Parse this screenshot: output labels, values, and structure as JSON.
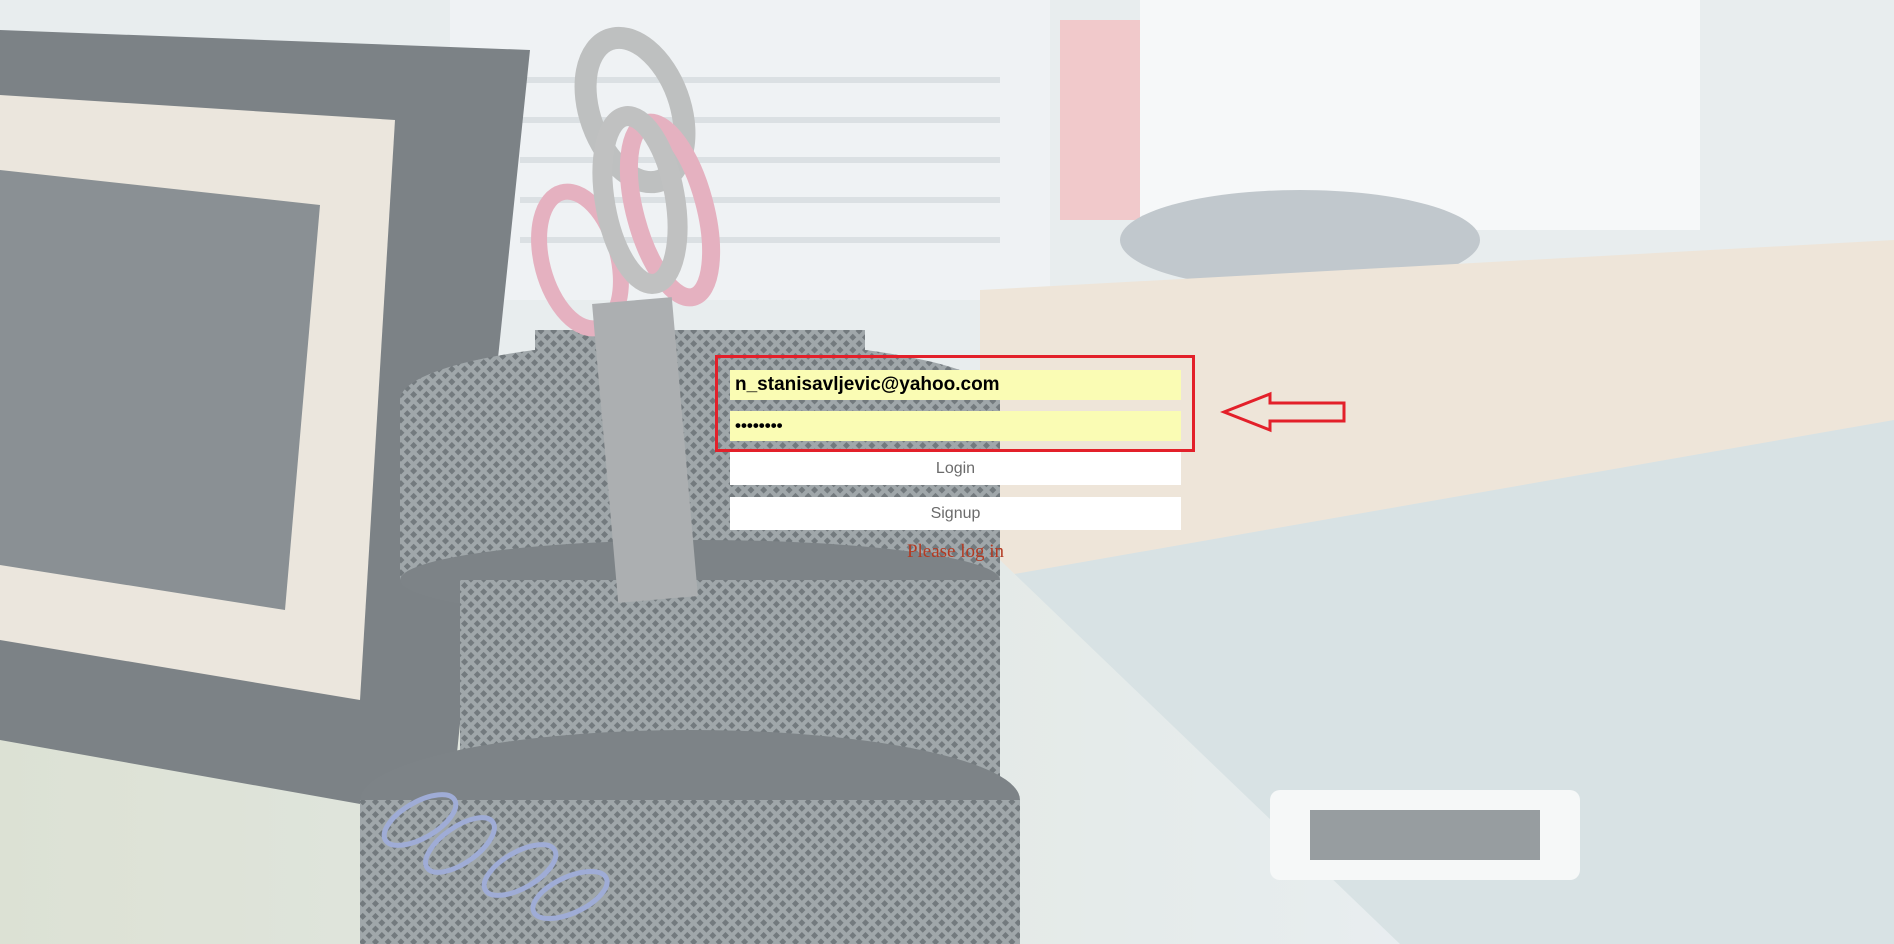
{
  "login": {
    "email_value": "n_stanisavljevic@yahoo.com",
    "password_value": "••••••••",
    "login_label": "Login",
    "signup_label": "Signup",
    "status_message": "Please log in"
  },
  "colors": {
    "field_background": "#fafcb4",
    "status_text": "#b33a22",
    "annotation": "#e3202a"
  }
}
